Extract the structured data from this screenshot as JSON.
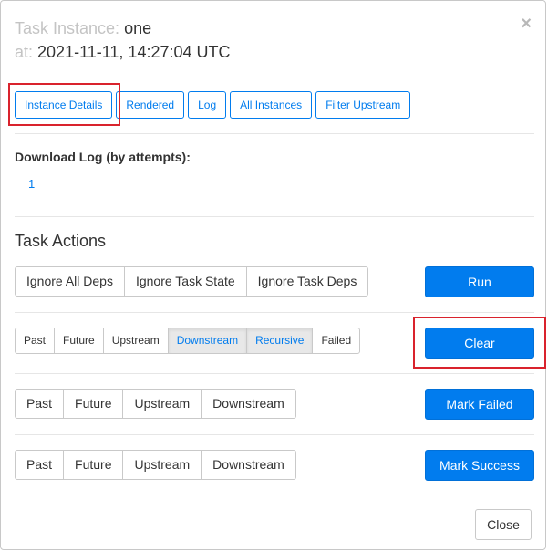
{
  "header": {
    "task_instance_label": "Task Instance:",
    "task_instance_value": "one",
    "at_label": "at:",
    "at_value": "2021-11-11, 14:27:04 UTC",
    "close_symbol": "×"
  },
  "tabs": [
    {
      "label": "Instance Details"
    },
    {
      "label": "Rendered"
    },
    {
      "label": "Log"
    },
    {
      "label": "All Instances"
    },
    {
      "label": "Filter Upstream"
    }
  ],
  "download_log": {
    "label": "Download Log (by attempts):",
    "attempts": [
      "1"
    ]
  },
  "task_actions": {
    "title": "Task Actions",
    "run_row": {
      "options": [
        "Ignore All Deps",
        "Ignore Task State",
        "Ignore Task Deps"
      ],
      "action_label": "Run"
    },
    "clear_row": {
      "options": [
        {
          "label": "Past",
          "active": false
        },
        {
          "label": "Future",
          "active": false
        },
        {
          "label": "Upstream",
          "active": false
        },
        {
          "label": "Downstream",
          "active": true
        },
        {
          "label": "Recursive",
          "active": true
        },
        {
          "label": "Failed",
          "active": false
        }
      ],
      "action_label": "Clear"
    },
    "mark_failed_row": {
      "options": [
        "Past",
        "Future",
        "Upstream",
        "Downstream"
      ],
      "action_label": "Mark Failed"
    },
    "mark_success_row": {
      "options": [
        "Past",
        "Future",
        "Upstream",
        "Downstream"
      ],
      "action_label": "Mark Success"
    }
  },
  "footer": {
    "close_label": "Close"
  },
  "colors": {
    "accent": "#017cee",
    "highlight": "#d9232d"
  }
}
